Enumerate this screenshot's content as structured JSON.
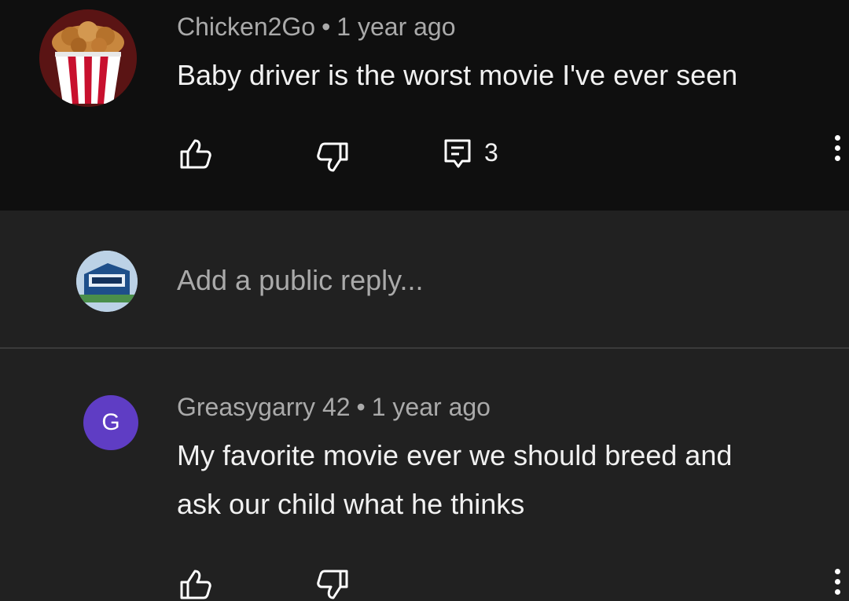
{
  "comments": [
    {
      "author": "Chicken2Go",
      "separator": "•",
      "time": "1 year ago",
      "text": "Baby driver is the worst movie I've ever seen",
      "reply_count": "3",
      "avatar": "chicken-bucket-avatar"
    },
    {
      "author": "Greasygarry 42",
      "separator": "•",
      "time": "1 year ago",
      "text_lines": [
        "My favorite movie ever we should breed and",
        "ask our child what he thinks"
      ],
      "avatar_letter": "G",
      "avatar_color": "#5f3dc4"
    }
  ],
  "reply_box": {
    "placeholder": "Add a public reply...",
    "avatar": "user-avatar"
  },
  "icons": {
    "like": "thumbs-up-icon",
    "dislike": "thumbs-down-icon",
    "replies": "comment-icon",
    "more": "more-vert-icon"
  },
  "colors": {
    "top_background": "#0f0f0f",
    "background": "#212121",
    "meta_text": "#aaaaaa",
    "body_text": "#f1f1f1"
  }
}
